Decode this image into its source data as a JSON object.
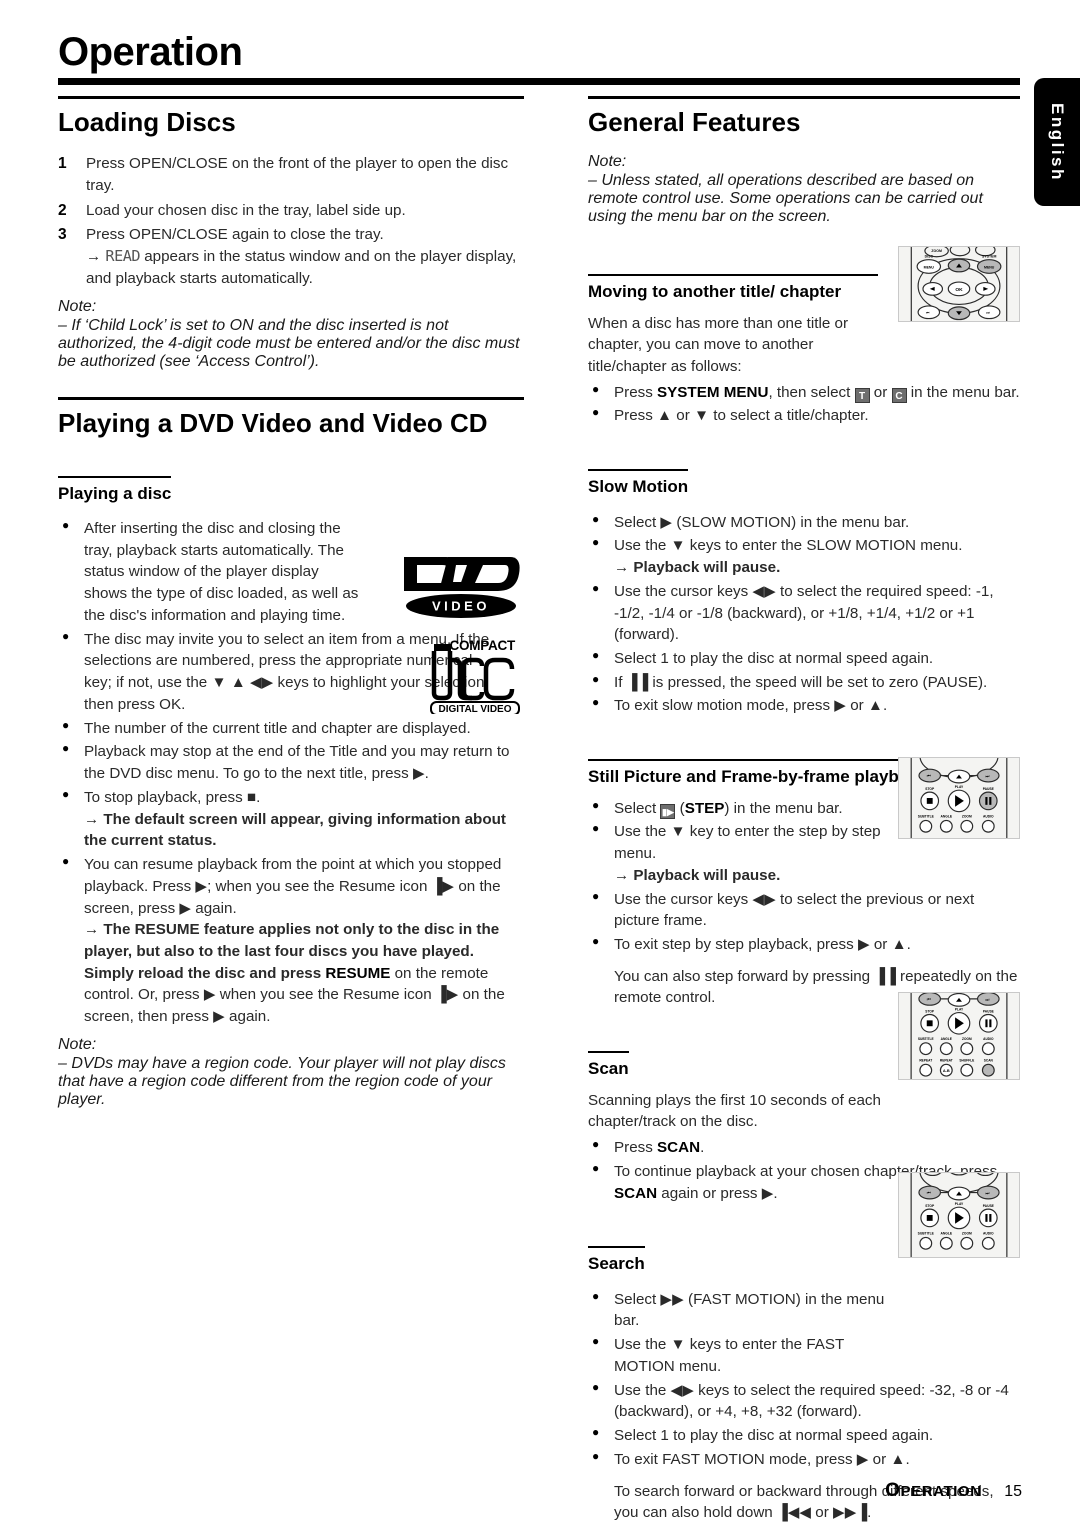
{
  "header": {
    "title": "Operation",
    "language_tab": "English"
  },
  "footer": {
    "section_label_first": "O",
    "section_label_rest": "PERATION",
    "page_number": "15"
  },
  "left_column": {
    "section_loading_discs": {
      "heading": "Loading Discs",
      "steps": [
        {
          "num": "1",
          "text": "Press OPEN/CLOSE on the front of the player to open the disc tray."
        },
        {
          "num": "2",
          "text": "Load your chosen disc in the tray, label side up."
        },
        {
          "num": "3",
          "text": "Press OPEN/CLOSE again to close the tray."
        }
      ],
      "step3_arrow_pre": "→ ",
      "step3_lcd": "READ",
      "step3_arrow_post": " appears in the status window and on the player display, and playback starts automatically.",
      "note_label": "Note:",
      "note_text": "–  If ‘Child Lock’ is set to ON and the disc inserted is not authorized, the 4-digit code must be entered and/or the disc must be authorized (see ‘Access Control’)."
    },
    "section_playing_dvd": {
      "heading": "Playing a DVD Video and Video CD",
      "subheading": "Playing a disc",
      "bullets": [
        "After inserting the disc and closing the tray, playback starts automatically. The status window of the player display shows the type of disc loaded, as well as the disc's information and playing time.",
        "The disc may invite you to select an item from a menu. If the selections are numbered, press the appropriate numerical key; if not, use the ▼ ▲ ◀▶ keys to highlight your selection, then press OK.",
        "The number of the current title and chapter are displayed.",
        "Playback may stop at the end of the Title and you may return to the DVD disc menu. To go to the next title, press ▶.",
        "To stop playback, press ■."
      ],
      "stop_arrow": "→ The default screen will appear, giving information about the current status.",
      "resume_bullet_pre": "You can resume playback from the point at which you stopped playback. Press ▶; when you see the Resume icon ▐▶ on the screen, press ▶ again.",
      "resume_arrow_pre": "→ The RESUME feature applies not only to the disc in the player, but also to the last four discs you have played. Simply reload the disc and press ",
      "resume_bold": "RESUME",
      "resume_arrow_post": " on the remote control. Or, press ▶ when you see the Resume icon ▐▶ on the screen, then press ▶ again.",
      "note_label": "Note:",
      "note_text": "–  DVDs may have a region code. Your player will not play discs that have a region code different from the region code of your player."
    },
    "logos": {
      "dvd_main": "DVD",
      "dvd_sub": "VIDEO",
      "cd_compact": "COMPACT",
      "cd_disc": "disc",
      "cd_digital_video": "DIGITAL VIDEO"
    }
  },
  "right_column": {
    "section_general_features": {
      "heading": "General Features",
      "note_label": "Note:",
      "note_text": "–  Unless stated, all operations described are based on remote control use.  Some operations can be carried out using the menu bar on the screen."
    },
    "section_moving": {
      "subheading": "Moving to another title/ chapter",
      "intro": "When a disc has more than one title or chapter, you can move to another title/chapter as follows:",
      "bullet1_pre": "Press ",
      "bullet1_bold": "SYSTEM MENU",
      "bullet1_mid": ", then select ",
      "bullet1_icon_t": "T",
      "bullet1_or": " or ",
      "bullet1_icon_c": "C",
      "bullet1_post": " in the menu bar.",
      "bullet2": "Press ▲ or ▼ to select a title/chapter."
    },
    "section_slow_motion": {
      "subheading": "Slow Motion",
      "bullets": [
        "Select ▶ (SLOW MOTION) in the menu bar.",
        "Use the ▼ keys to enter the SLOW MOTION menu.",
        "Use the cursor keys ◀▶ to select the required speed: -1, -1/2, -1/4 or -1/8 (backward), or +1/8, +1/4, +1/2 or +1 (forward).",
        "Select 1 to play the disc at normal speed again.",
        "If ▐▐ is pressed, the speed will be set to zero (PAUSE).",
        "To exit slow motion mode, press ▶ or ▲."
      ],
      "pause_arrow": "→ Playback will pause."
    },
    "section_still_picture": {
      "subheading": "Still Picture and Frame-by-frame playback",
      "bullet1_pre": "Select ",
      "bullet1_icon": "▮▶",
      "bullet1_mid": " (",
      "bullet1_bold": "STEP",
      "bullet1_post": ") in the menu bar.",
      "bullet2": "Use the ▼ key to enter the step by step menu.",
      "pause_arrow": "→ Playback will pause.",
      "bullet3": "Use the cursor keys ◀▶ to select the previous or next picture frame.",
      "bullet4": "To exit step by step playback, press ▶ or ▲.",
      "closing": "You can also step forward by pressing ▐▐ repeatedly on the remote control."
    },
    "section_scan": {
      "subheading": "Scan",
      "intro": "Scanning plays the first 10 seconds of each chapter/track on the disc.",
      "bullet1_pre": "Press ",
      "bullet1_bold": "SCAN",
      "bullet1_post": ".",
      "bullet2_pre": "To continue playback at your chosen chapter/track, press ",
      "bullet2_bold": "SCAN",
      "bullet2_post": " again or press ▶."
    },
    "section_search": {
      "subheading": "Search",
      "bullets": [
        "Select ▶▶ (FAST MOTION) in the menu bar.",
        "Use the ▼ keys to enter the FAST MOTION menu.",
        "Use the ◀▶ keys to select the required speed: -32, -8 or -4 (backward), or +4, +8, +32 (forward).",
        "Select 1 to play the disc at normal speed again.",
        "To exit FAST MOTION mode, press ▶ or ▲."
      ],
      "closing": "To search forward or backward through different speeds, you can also hold down ▐◀◀ or ▶▶▐."
    },
    "remote_labels": {
      "r1": [
        "ZOOM",
        "U",
        "DISC MENU",
        "SYSTEM MENU",
        "OK"
      ],
      "r2": [
        "STOP",
        "PLAY",
        "PAUSE",
        "SUBTITLE",
        "ANGLE",
        "ZOOM",
        "AUDIO"
      ],
      "r3": [
        "STOP",
        "PLAY",
        "PAUSE",
        "SUBTITLE",
        "ANGLE",
        "ZOOM",
        "AUDIO",
        "REPEAT",
        "REPEAT A-B",
        "SHUFFLE",
        "SCAN"
      ],
      "r4": [
        "STOP",
        "PLAY",
        "PAUSE",
        "SUBTITLE",
        "ANGLE",
        "ZOOM",
        "AUDIO"
      ]
    }
  }
}
